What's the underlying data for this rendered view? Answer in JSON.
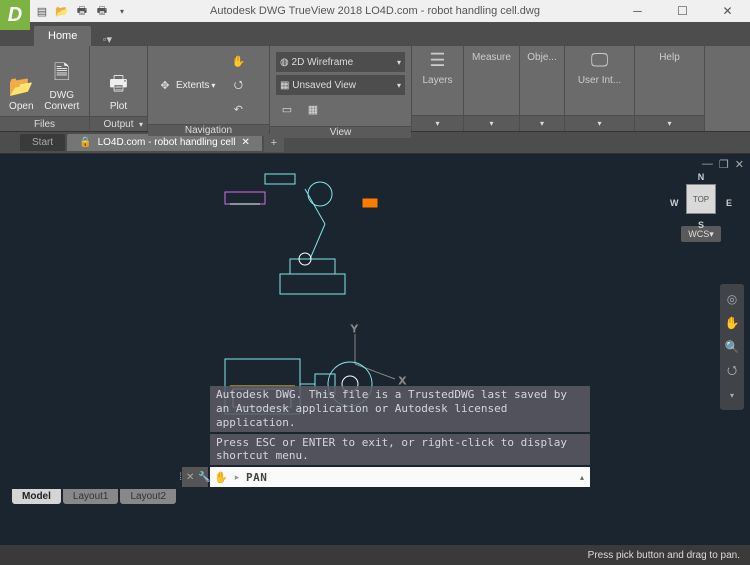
{
  "app": {
    "logo": "D",
    "title": "Autodesk DWG TrueView 2018    LO4D.com - robot handling cell.dwg"
  },
  "ribbon": {
    "tabs": {
      "home": "Home"
    },
    "panels": {
      "files": {
        "label": "Files",
        "open": "Open",
        "convert": "DWG\nConvert"
      },
      "output": {
        "label": "Output",
        "plot": "Plot"
      },
      "navigation": {
        "label": "Navigation",
        "extents": "Extents"
      },
      "view": {
        "label": "View",
        "visual_style": "2D Wireframe",
        "view_name": "Unsaved View"
      },
      "layers": {
        "label": "Layers"
      },
      "measure": {
        "label": "Measure"
      },
      "obj": {
        "label": "Obje..."
      },
      "ui": {
        "label": "User Int..."
      },
      "help": {
        "label": "Help"
      }
    }
  },
  "doctabs": {
    "start": "Start",
    "active": "LO4D.com - robot handling cell"
  },
  "viewport": {
    "viewcube": {
      "face": "TOP",
      "n": "N",
      "s": "S",
      "e": "E",
      "w": "W",
      "wcs": "WCS"
    },
    "layout_tabs": [
      "Model",
      "Layout1",
      "Layout2"
    ]
  },
  "command": {
    "history1": "Autodesk DWG.  This file is a TrustedDWG last saved by an Autodesk application or Autodesk licensed application.",
    "history2": "Press ESC or ENTER to exit, or right-click to display shortcut menu.",
    "current": "PAN"
  },
  "status": {
    "hint": "Press pick button and drag to pan."
  }
}
